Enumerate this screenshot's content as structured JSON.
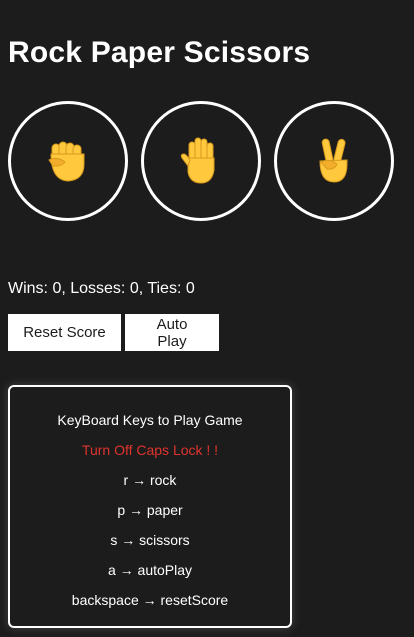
{
  "title": "Rock Paper Scissors",
  "moves": [
    {
      "name": "rock",
      "icon": "raised-fist-icon"
    },
    {
      "name": "paper",
      "icon": "raised-hand-icon"
    },
    {
      "name": "scissors",
      "icon": "victory-hand-icon"
    }
  ],
  "score_text": "Wins: 0, Losses: 0, Ties: 0",
  "controls": {
    "reset_label": "Reset Score",
    "auto_label": "Auto Play"
  },
  "keys_panel": {
    "heading": "KeyBoard Keys to Play Game",
    "warning": "Turn Off Caps Lock ! !",
    "mappings": [
      "r → rock",
      "p → paper",
      "s → scissors",
      "a → autoPlay",
      "backspace → resetScore"
    ]
  },
  "colors": {
    "background": "#1c1c1c",
    "text": "#ffffff",
    "warning": "#e0332e",
    "emoji": "#ffc83d"
  }
}
